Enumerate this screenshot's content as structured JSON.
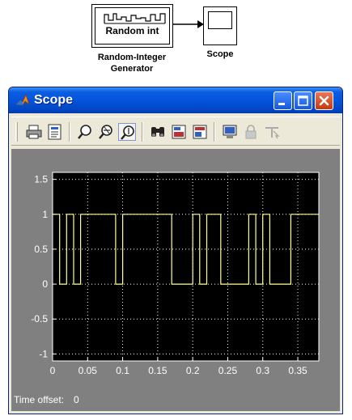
{
  "model": {
    "source_block": {
      "icon_text": "Random int",
      "caption_line1": "Random-Integer",
      "caption_line2": "Generator"
    },
    "sink_block": {
      "caption": "Scope"
    }
  },
  "window": {
    "title": "Scope",
    "controls": [
      "minimize",
      "maximize",
      "close"
    ]
  },
  "toolbar": {
    "tools": [
      "print-icon",
      "parameters-icon",
      "zoom-icon",
      "zoom-x-icon",
      "zoom-y-icon",
      "autoscale-binoculars-icon",
      "save-axes-settings-icon",
      "restore-axes-settings-icon",
      "floating-scope-icon",
      "lock-axes-icon",
      "signal-selector-icon"
    ]
  },
  "status": {
    "time_offset_label": "Time offset:",
    "time_offset_value": "0"
  },
  "colors": {
    "plot_background": "#000000",
    "signal": "#ffff99",
    "grid": "#ffffff",
    "axes_text": "#ffffff",
    "panel": "#808080"
  },
  "chart_data": {
    "type": "line",
    "style": "step",
    "title": "",
    "xlabel": "",
    "ylabel": "",
    "xlim": [
      0,
      0.38
    ],
    "ylim": [
      -1.1,
      1.6
    ],
    "x_ticks": [
      0,
      0.05,
      0.1,
      0.15,
      0.2,
      0.25,
      0.3,
      0.35
    ],
    "x_tick_labels": [
      "0",
      "0.05",
      "0.1",
      "0.15",
      "0.2",
      "0.25",
      "0.3",
      "0.35"
    ],
    "y_ticks": [
      -1,
      -0.5,
      0,
      0.5,
      1,
      1.5
    ],
    "y_tick_labels": [
      "-1",
      "-0.5",
      "0",
      "0.5",
      "1",
      "1.5"
    ],
    "grid": true,
    "series": [
      {
        "x": [
          0,
          0.01,
          0.01,
          0.02,
          0.02,
          0.03,
          0.03,
          0.04,
          0.04,
          0.09,
          0.09,
          0.1,
          0.1,
          0.17,
          0.17,
          0.2,
          0.2,
          0.21,
          0.21,
          0.22,
          0.22,
          0.24,
          0.24,
          0.28,
          0.28,
          0.29,
          0.29,
          0.3,
          0.3,
          0.31,
          0.31,
          0.34,
          0.34,
          0.38
        ],
        "y": [
          1,
          1,
          0,
          0,
          1,
          1,
          0,
          0,
          1,
          1,
          0,
          0,
          1,
          1,
          0,
          0,
          1,
          1,
          0,
          0,
          1,
          1,
          0,
          0,
          1,
          1,
          0,
          0,
          1,
          1,
          0,
          0,
          1,
          1
        ]
      }
    ]
  }
}
